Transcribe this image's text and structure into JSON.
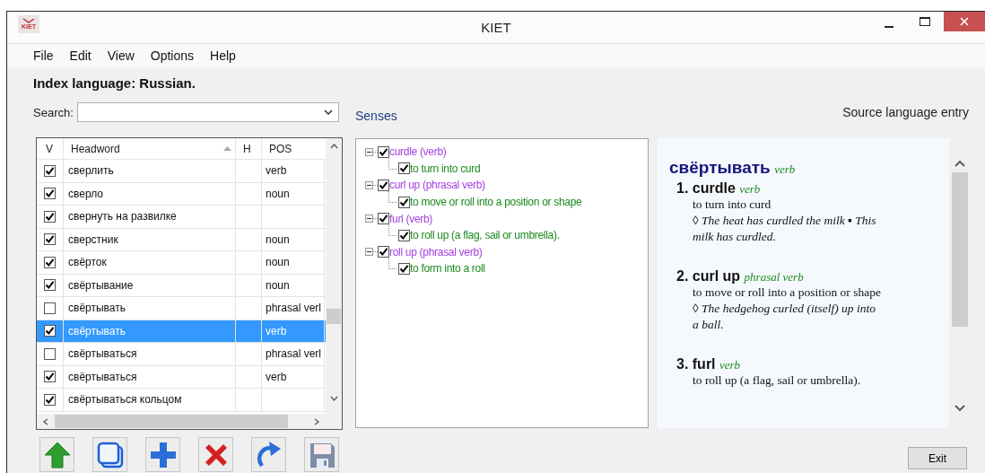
{
  "window": {
    "title": "KIET",
    "logo_text": "KIET"
  },
  "menu": [
    "File",
    "Edit",
    "View",
    "Options",
    "Help"
  ],
  "index_language": "Index language: Russian.",
  "search": {
    "label": "Search:"
  },
  "headwords": {
    "columns": [
      "V",
      "Headword",
      "H",
      "POS"
    ],
    "rows": [
      {
        "checked": true,
        "headword": "сверлить",
        "pos": "verb",
        "selected": false
      },
      {
        "checked": true,
        "headword": "сверло",
        "pos": "noun",
        "selected": false
      },
      {
        "checked": true,
        "headword": "свернуть на развилке",
        "pos": "",
        "selected": false
      },
      {
        "checked": true,
        "headword": "сверстник",
        "pos": "noun",
        "selected": false
      },
      {
        "checked": true,
        "headword": "свёрток",
        "pos": "noun",
        "selected": false
      },
      {
        "checked": true,
        "headword": "свёртывание",
        "pos": "noun",
        "selected": false
      },
      {
        "checked": false,
        "headword": "свёртывать",
        "pos": "phrasal verl",
        "selected": false
      },
      {
        "checked": true,
        "headword": "свёртывать",
        "pos": "verb",
        "selected": true
      },
      {
        "checked": false,
        "headword": "свёртываться",
        "pos": "phrasal verl",
        "selected": false
      },
      {
        "checked": true,
        "headword": "свёртываться",
        "pos": "verb",
        "selected": false
      },
      {
        "checked": true,
        "headword": "свёртываться кольцом",
        "pos": "",
        "selected": false
      }
    ]
  },
  "senses": {
    "label": "Senses",
    "tree": [
      {
        "label": "curdle (verb)",
        "checked": true,
        "expanded": true,
        "children": [
          {
            "label": "to turn into curd",
            "checked": true
          }
        ]
      },
      {
        "label": "curl up (phrasal verb)",
        "checked": true,
        "expanded": true,
        "children": [
          {
            "label": "to move or roll into a position or shape",
            "checked": true
          }
        ]
      },
      {
        "label": "furl (verb)",
        "checked": true,
        "expanded": true,
        "children": [
          {
            "label": "to roll up (a flag, sail or umbrella).",
            "checked": true
          }
        ]
      },
      {
        "label": "roll up (phrasal verb)",
        "checked": true,
        "expanded": true,
        "children": [
          {
            "label": "to form into a roll",
            "checked": true
          }
        ]
      }
    ]
  },
  "entry": {
    "label": "Source language entry",
    "headword": "свёртывать",
    "pos": "verb",
    "senses": [
      {
        "number": "1.",
        "word": "curdle",
        "pos": "verb",
        "definition": "to turn into curd",
        "example": "◊ The heat has curdled the milk ▪ This milk has curdled."
      },
      {
        "number": "2.",
        "word": "curl up",
        "pos": "phrasal verb",
        "definition": "to move or roll into a position or shape",
        "example": "◊ The hedgehog curled (itself) up into a ball."
      },
      {
        "number": "3.",
        "word": "furl",
        "pos": "verb",
        "definition": "to roll up (a flag, sail or umbrella)."
      }
    ]
  },
  "toolbar": [
    {
      "kind": "up"
    },
    {
      "kind": "copy"
    },
    {
      "kind": "add"
    },
    {
      "kind": "delete"
    },
    {
      "kind": "redo"
    },
    {
      "kind": "save"
    }
  ],
  "exit_button": "Exit"
}
